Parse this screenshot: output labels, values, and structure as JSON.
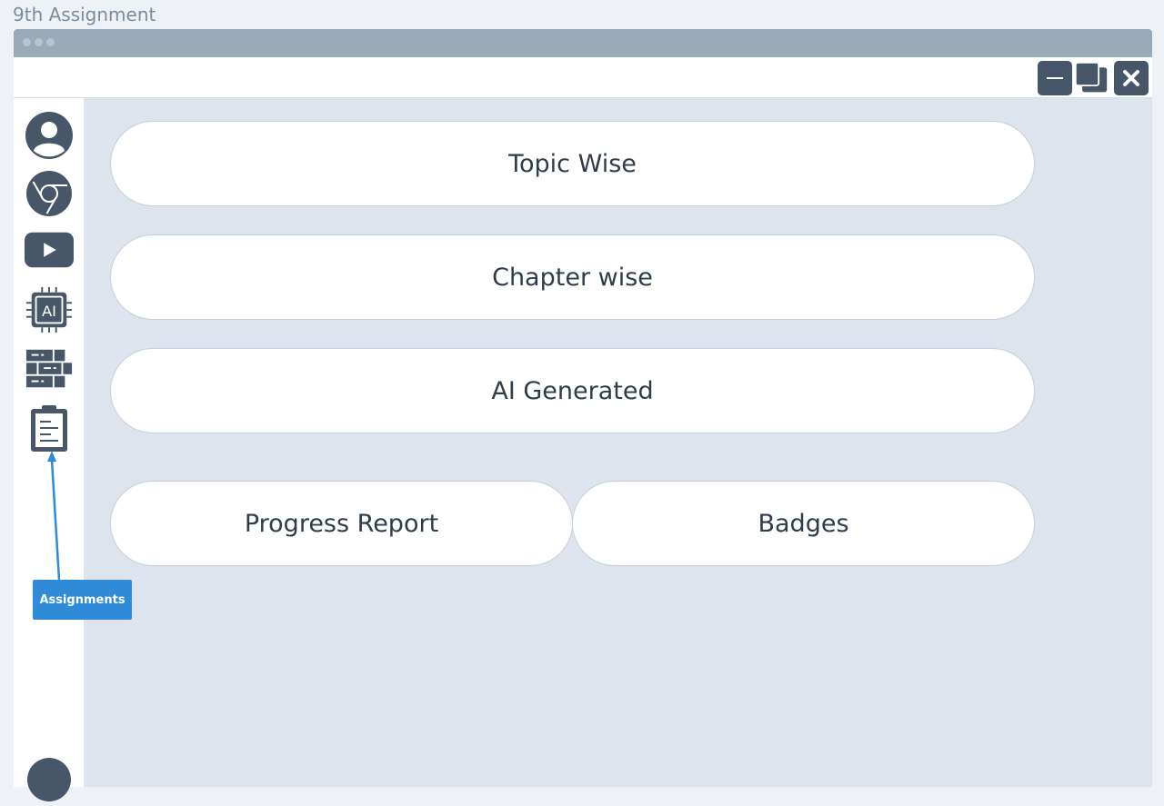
{
  "page": {
    "title": "9th Assignment"
  },
  "window": {
    "controls": {
      "minimize_icon": "minimize-icon",
      "maximize_icon": "restore-icon",
      "close_icon": "close-icon"
    }
  },
  "sidebar": {
    "items": [
      {
        "name": "profile",
        "icon": "user-icon"
      },
      {
        "name": "chrome",
        "icon": "chrome-icon"
      },
      {
        "name": "youtube",
        "icon": "youtube-icon"
      },
      {
        "name": "ai",
        "icon": "ai-chip-icon",
        "label": "AI"
      },
      {
        "name": "bricks",
        "icon": "bricks-icon"
      },
      {
        "name": "assignments",
        "icon": "clipboard-icon"
      }
    ],
    "bottom_avatar": "avatar"
  },
  "main": {
    "buttons": {
      "topic_wise": "Topic Wise",
      "chapter_wise": "Chapter wise",
      "ai_generated": "AI Generated",
      "progress_report": "Progress Report",
      "badges": "Badges"
    }
  },
  "tooltip": {
    "label": "Assignments"
  },
  "colors": {
    "background": "#eef2f6",
    "titlebar": "#9aaab8",
    "main": "#dde4ed",
    "icon": "#475769",
    "tooltip": "#2f8ad8"
  }
}
